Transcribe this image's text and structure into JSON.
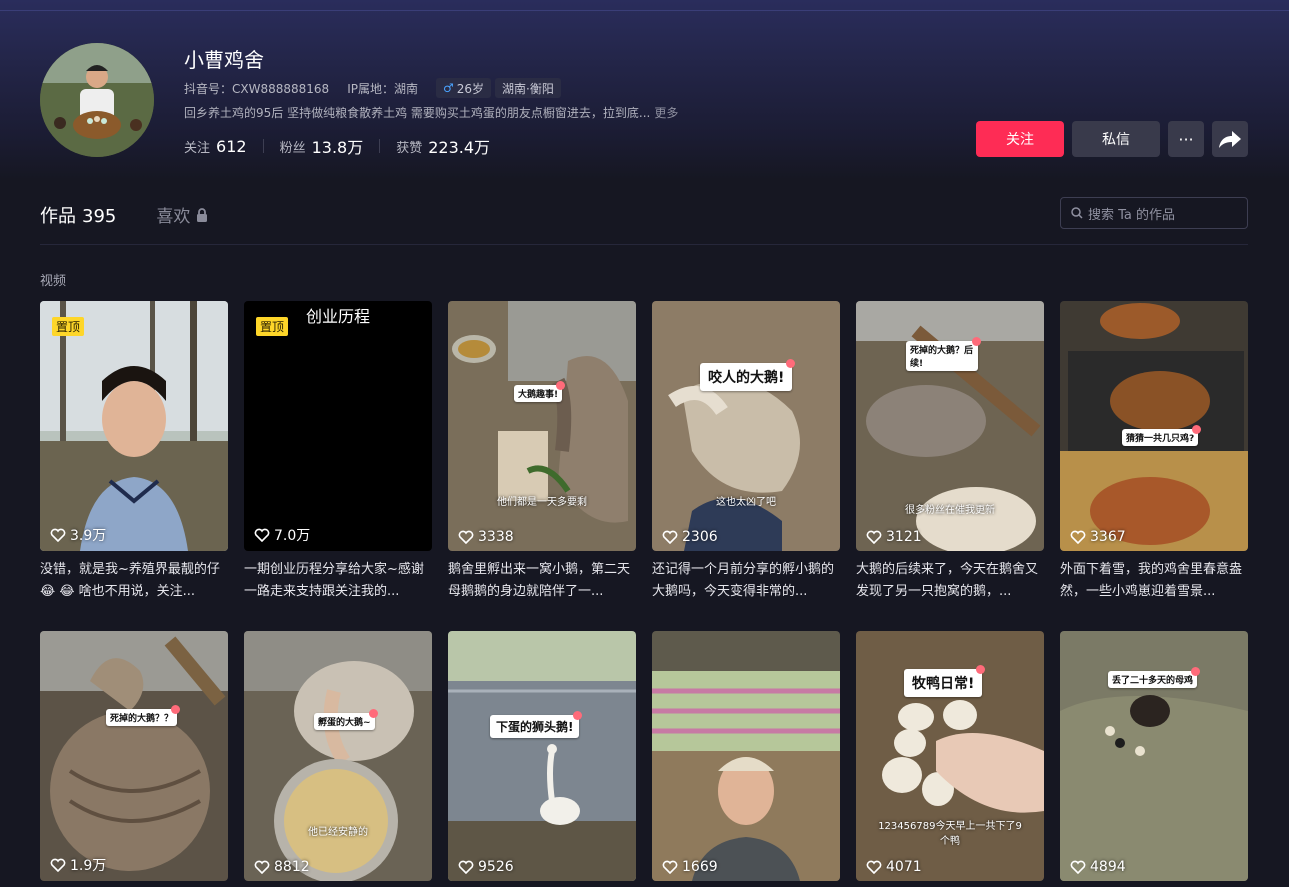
{
  "profile": {
    "name": "小曹鸡舍",
    "douyin_id": "抖音号：CXW888888168",
    "ip_location": "IP属地：湖南",
    "age_tag": "26岁",
    "region_tag": "湖南·衡阳",
    "bio": "回乡养土鸡的95后 坚持做纯粮食散养土鸡 需要购买土鸡蛋的朋友点橱窗进去，拉到底...",
    "bio_more": "更多",
    "stats": [
      {
        "label": "关注",
        "value": "612"
      },
      {
        "label": "粉丝",
        "value": "13.8万"
      },
      {
        "label": "获赞",
        "value": "223.4万"
      }
    ]
  },
  "actions": {
    "follow": "关注",
    "message": "私信",
    "more": "···"
  },
  "tabs": {
    "works_label": "作品",
    "works_count": "395",
    "likes_label": "喜欢"
  },
  "search": {
    "placeholder": "搜索 Ta 的作品"
  },
  "section_label": "视频",
  "pin_label": "置顶",
  "videos": [
    {
      "likes": "3.9万",
      "caption": "没错，就是我~养殖界最靓的仔 😂 😂 啥也不用说，关注..."
    },
    {
      "likes": "7.0万",
      "caption": "一期创业历程分享给大家~感谢一路走来支持跟关注我的...",
      "overlay": "创业历程"
    },
    {
      "likes": "3338",
      "caption": "鹅舍里孵出来一窝小鹅，第二天母鹅鹅的身边就陪伴了一...",
      "sticker": "大鹅趣事!",
      "subtitle": "他们都是一天多要剩"
    },
    {
      "likes": "2306",
      "caption": "还记得一个月前分享的孵小鹅的大鹅吗，今天变得非常的...",
      "sticker": "咬人的大鹅!",
      "subtitle": "这也太凶了吧"
    },
    {
      "likes": "3121",
      "caption": "大鹅的后续来了，今天在鹅舍又发现了另一只抱窝的鹅，...",
      "sticker": "死掉的大鹅？后续!",
      "subtitle": "很多粉丝在催我更新"
    },
    {
      "likes": "3367",
      "caption": "外面下着雪，我的鸡舍里春意盎然，一些小鸡崽迎着雪景...",
      "sticker": "猜猜一共几只鸡?"
    },
    {
      "likes": "1.9万",
      "caption": "",
      "sticker": "死掉的大鹅？？"
    },
    {
      "likes": "8812",
      "caption": "",
      "sticker": "孵蛋的大鹅~",
      "subtitle": "他已经安静的"
    },
    {
      "likes": "9526",
      "caption": "",
      "sticker": "下蛋的狮头鹅!"
    },
    {
      "likes": "1669",
      "caption": ""
    },
    {
      "likes": "4071",
      "caption": "",
      "sticker": "牧鸭日常!",
      "subtitle": "123456789今天早上一共下了9个鸭"
    },
    {
      "likes": "4894",
      "caption": "",
      "sticker": "丢了二十多天的母鸡"
    }
  ],
  "colors": {
    "accent": "#fe2c55",
    "pin": "#fed629",
    "background": "#161722"
  }
}
